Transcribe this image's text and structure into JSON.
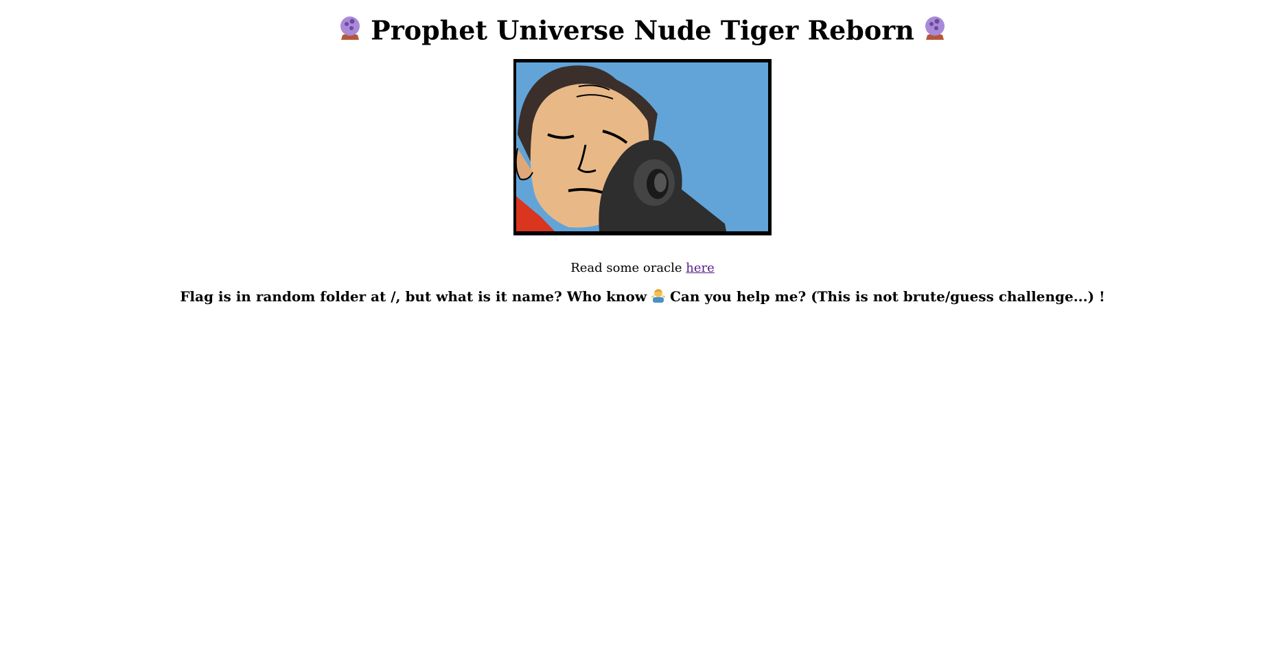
{
  "header": {
    "title": "Prophet Universe Nude Tiger Reborn",
    "left_icon": "crystal-ball-icon",
    "right_icon": "crystal-ball-icon"
  },
  "picture": {
    "colors": {
      "sky": "#62a4d8",
      "skin": "#e8b987",
      "shirt": "#d9351f",
      "cannon": "#2e2e2e",
      "frame": "#000000"
    }
  },
  "oracle": {
    "prefix": "Read some oracle",
    "link_text": "here"
  },
  "message": {
    "part1": "Flag is in random folder at /, but what is it name? Who know",
    "icon": "person-shrugging-icon",
    "part2": "Can you help me? (This is not brute/guess challenge...) !"
  }
}
